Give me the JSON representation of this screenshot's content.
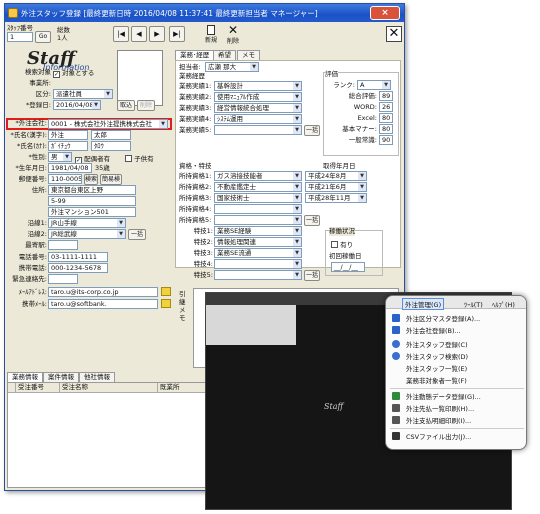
{
  "window": {
    "title": "外注スタッフ登録 [最終更新日時 2016/04/08 11:37:41 最終更新担当者 マネージャー]",
    "close": "×"
  },
  "toolbar": {
    "staff_no_label": "ｽﾀｯﾌ番号",
    "staff_no": "1",
    "go": "Go",
    "total_label": "総数",
    "total": "1人",
    "first": "|◀",
    "prev": "◀",
    "next": "▶",
    "last": "▶|",
    "new": "新規",
    "delete": "削除"
  },
  "logo": {
    "line1": "Staff",
    "line2": "Information"
  },
  "left": {
    "search_label": "検索対象",
    "search_value": "対象とする",
    "office_label": "事業所:",
    "office": "",
    "class_label": "区分:",
    "class": "派遣社員",
    "regdate_label": "*登録日:",
    "regdate": "2016/04/08",
    "regdate_btn": "取込",
    "clear_btn": "削除",
    "company_label": "*外注会社:",
    "company": "0001 - 株式会社外注提携株式会社",
    "name_label": "*氏名(漢字):",
    "last": "外注",
    "first": "太郎",
    "kana_label": "*氏名(ｶﾅ):",
    "last_kana": "ｶﾞｲﾁｭｳ",
    "first_kana": "ﾀﾛｳ",
    "gender_label": "*性別:",
    "gender": "男",
    "spouse": "配偶者有",
    "children": "子供有",
    "birth_label": "*生年月日:",
    "birth": "1981/04/08",
    "age": "35歳",
    "zip_label": "郵便番号:",
    "zip": "110-0005",
    "zip_search": "検索",
    "zip_clear": "簡易検",
    "addr_label": "住所:",
    "addr1": "東京都台東区上野",
    "addr2": "5-99",
    "addr3": "外注マンション501",
    "line1_label": "沿線1:",
    "line1": "JR山手線",
    "line2_label": "沿線2:",
    "line2": "JR総武線",
    "line_btn": "一括",
    "station_label": "最寄駅:",
    "station": "",
    "tel_label": "電話番号:",
    "tel": "03-1111-1111",
    "mobile_label": "携帯電話:",
    "mobile": "000-1234-5678",
    "emergency_label": "緊急連絡先:",
    "emergency": "",
    "mail_label": "ﾒｰﾙｱﾄﾞﾚｽ:",
    "mail": "taro.u@its-corp.co.jp",
    "mobmail_label": "携帯ﾒｰﾙ:",
    "mobmail": "taro.u@softbank."
  },
  "tabs": [
    {
      "label": "業務･経歴"
    },
    {
      "label": "希望"
    },
    {
      "label": "メモ"
    }
  ],
  "right": {
    "charge_label": "担当者:",
    "charge": "広瀬 那大",
    "history_label": "業務経歴",
    "jobs": [
      {
        "label": "業務実績1:",
        "value": "基幹設計"
      },
      {
        "label": "業務実績2:",
        "value": "使用ﾏﾆｭｱﾙ作成"
      },
      {
        "label": "業務実績3:",
        "value": "経営情報統合処理"
      },
      {
        "label": "業務実績4:",
        "value": "ｼｽﾃﾑ運用"
      },
      {
        "label": "業務実績5:",
        "value": ""
      }
    ],
    "bulk": "一括",
    "eval_label": "評価",
    "rank_label": "ランク:",
    "rank": "A",
    "scores": [
      {
        "label": "総合評価:",
        "value": "89"
      },
      {
        "label": "WORD:",
        "value": "26"
      },
      {
        "label": "Excel:",
        "value": "80"
      },
      {
        "label": "基本マナー:",
        "value": "80"
      },
      {
        "label": "一般常識:",
        "value": "90"
      }
    ],
    "skill_label": "資格・特技",
    "date_label": "取得年月日",
    "quals": [
      {
        "label": "所持資格1:",
        "value": "ガス溶接技能者",
        "date": "平成24年8月"
      },
      {
        "label": "所持資格2:",
        "value": "不動産鑑定士",
        "date": "平成21年6月"
      },
      {
        "label": "所持資格3:",
        "value": "国家技術士",
        "date": "平成28年11月"
      },
      {
        "label": "所持資格4:",
        "value": "",
        "date": ""
      },
      {
        "label": "所持資格5:",
        "value": "",
        "date": ""
      }
    ],
    "skills": [
      {
        "label": "特技1:",
        "value": "業務SE経験"
      },
      {
        "label": "特技2:",
        "value": "情報処理関連"
      },
      {
        "label": "特技3:",
        "value": "業務SE流通"
      },
      {
        "label": "特技4:",
        "value": ""
      },
      {
        "label": "特技5:",
        "value": ""
      }
    ],
    "status_label": "稼働状況",
    "status": "有り",
    "first_date_label": "初回稼働日",
    "first_date": "__/__/__",
    "memo_label": "引継メモ"
  },
  "bottom": {
    "tabs": [
      {
        "label": "業務情報"
      },
      {
        "label": "案件情報"
      },
      {
        "label": "他社情報"
      }
    ],
    "col1": "受注番号",
    "col2": "受注名称",
    "col3": "既業所"
  },
  "inset": {
    "menubar": [
      "外注管理(G)",
      "ﾂｰﾙ(T)",
      "ﾍﾙﾌﾟ(H)"
    ],
    "strip": "業務情報",
    "items": [
      {
        "label": "外注区分マスタ登録(A)...",
        "icon": "#2a62c9"
      },
      {
        "label": "外注会社登録(B)...",
        "icon": "#2a62c9"
      },
      {
        "label": "外注スタッフ登録(C)",
        "icon": "#3a6fd0"
      },
      {
        "label": "外注スタッフ検索(D)",
        "icon": "#3a6fd0"
      },
      {
        "label": "外注スタッフ一覧(E)",
        "icon": "#cccccc"
      },
      {
        "label": "業務非対象者一覧(F)",
        "icon": "#cccccc"
      },
      {
        "label": "外注動態データ登録(G)...",
        "icon": "#2e8b3e"
      },
      {
        "label": "外注先払一覧印刷(H)...",
        "icon": "#555555"
      },
      {
        "label": "外注支払明細印刷(I)...",
        "icon": "#555555"
      },
      {
        "label": "CSVファイル出力(J)...",
        "icon": "#333333"
      }
    ],
    "staff_logo": "Staff"
  }
}
